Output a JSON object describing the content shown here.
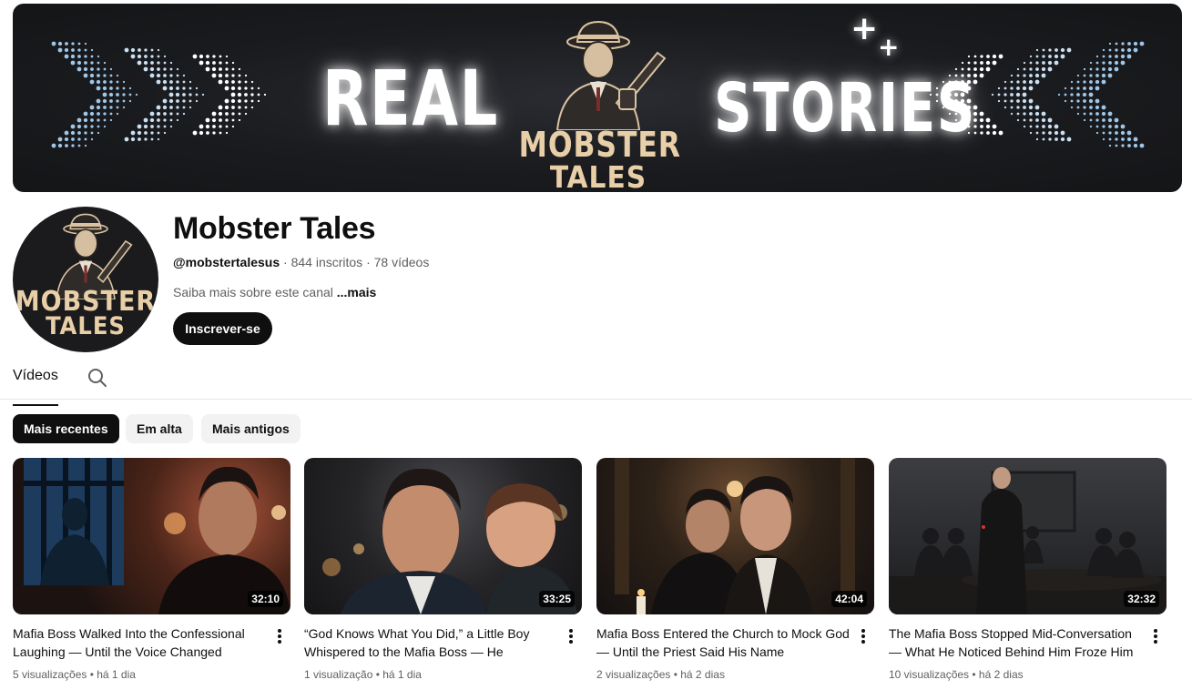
{
  "banner": {
    "word_left": "REAL",
    "word_right": "STORIES",
    "logo_line1": "MOBSTER",
    "logo_line2": "TALES",
    "plus_glyph": "+"
  },
  "channel": {
    "name": "Mobster Tales",
    "handle": "@mobstertalesus",
    "subscribers": " · 844 inscritos · 78 vídeos",
    "description": "Saiba mais sobre este canal ",
    "more": "...mais",
    "subscribe_label": "Inscrever-se",
    "avatar_line1": "MOBSTER",
    "avatar_line2": "TALES"
  },
  "tabs": {
    "videos": "Vídeos",
    "search_icon": "search-icon"
  },
  "chips": [
    "Mais recentes",
    "Em alta",
    "Mais antigos"
  ],
  "videos": [
    {
      "title": "Mafia Boss Walked Into the Confessional Laughing — Until the Voice Changed",
      "duration": "32:10",
      "meta": "5 visualizações • há 1 dia"
    },
    {
      "title": "“God Knows What You Did,” a Little Boy Whispered to the Mafia Boss — He Turned…",
      "duration": "33:25",
      "meta": "1 visualização • há 1 dia"
    },
    {
      "title": "Mafia Boss Entered the Church to Mock God — Until the Priest Said His Name",
      "duration": "42:04",
      "meta": "2 visualizações • há 2 dias"
    },
    {
      "title": "The Mafia Boss Stopped Mid-Conversation — What He Noticed Behind Him Froze Him",
      "duration": "32:32",
      "meta": "10 visualizações • há 2 dias"
    }
  ],
  "colors": {
    "text_primary": "#0f0f0f",
    "text_secondary": "#606060",
    "chip_bg": "#f2f2f2",
    "logo_cream": "#e8cfa8"
  }
}
